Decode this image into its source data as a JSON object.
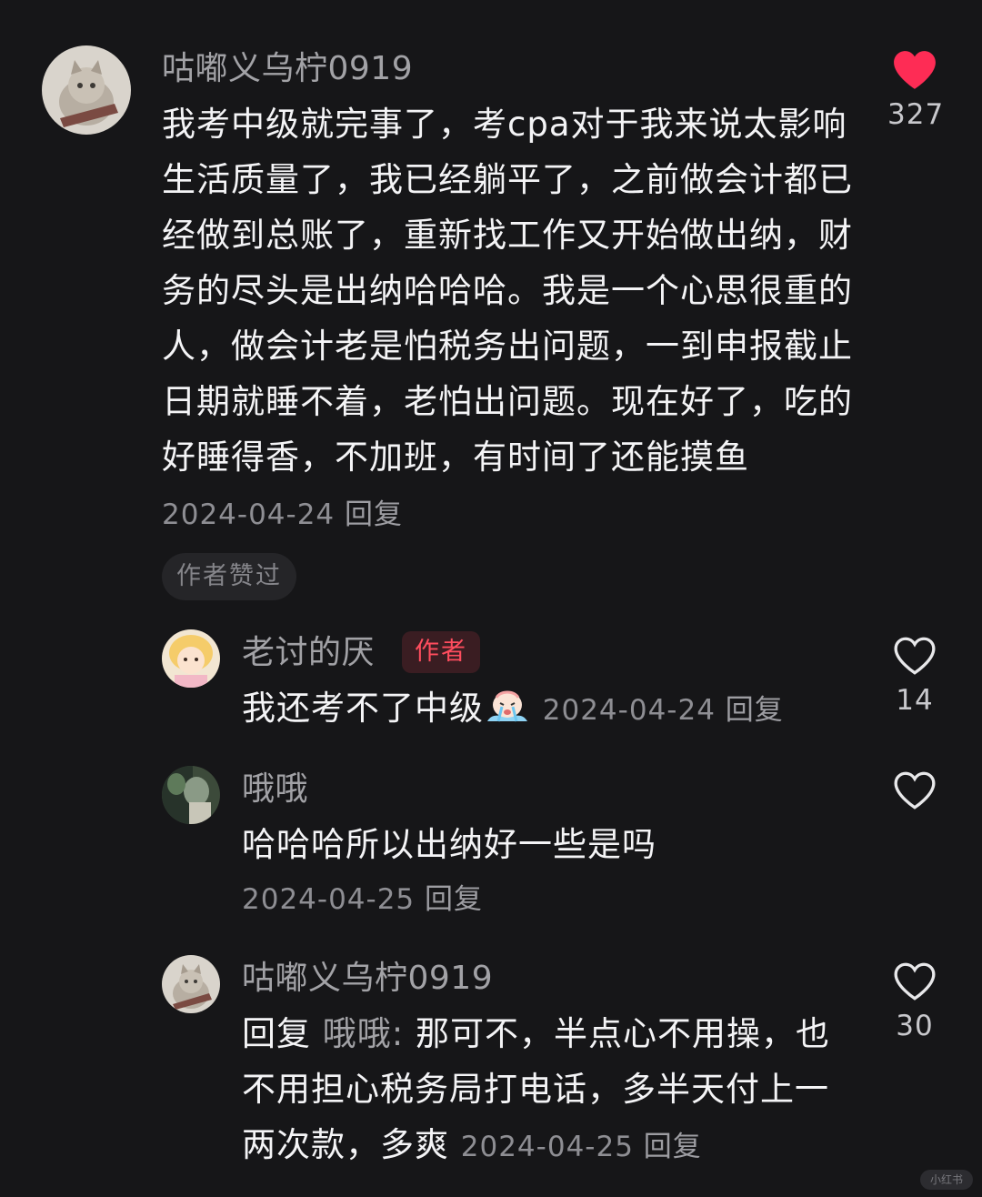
{
  "comments": [
    {
      "username": "咕嘟义乌柠0919",
      "content": "我考中级就完事了，考cpa对于我来说太影响生活质量了，我已经躺平了，之前做会计都已经做到总账了，重新找工作又开始做出纳，财务的尽头是出纳哈哈哈。我是一个心思很重的人，做会计老是怕税务出问题，一到申报截止日期就睡不着，老怕出问题。现在好了，吃的好睡得香，不加班，有时间了还能摸鱼",
      "date": "2024-04-24",
      "reply_label": "回复",
      "likes": "327",
      "liked": true,
      "author_liked_label": "作者赞过"
    },
    {
      "username": "老讨的厌",
      "badge": "作者",
      "content": "我还考不了中级",
      "emoji": "crying-face-emoji",
      "date": "2024-04-24",
      "reply_label": "回复",
      "likes": "14",
      "liked": false
    },
    {
      "username": "哦哦",
      "content": "哈哈哈所以出纳好一些是吗",
      "date": "2024-04-25",
      "reply_label": "回复",
      "likes": "",
      "liked": false
    },
    {
      "username": "咕嘟义乌柠0919",
      "reply_prefix": "回复",
      "reply_target": "哦哦:",
      "content": "那可不，半点心不用操，也不用担心税务局打电话，多半天付上一两次款，多爽",
      "date": "2024-04-25",
      "reply_label": "回复",
      "likes": "30",
      "liked": false
    }
  ],
  "icons": {
    "like_filled": "heart-filled-icon",
    "like_outline": "heart-outline-icon"
  },
  "colors": {
    "background": "#161618",
    "like_red": "#fe2c55",
    "author_badge": "#ff4d5e"
  },
  "watermark": "小红书"
}
